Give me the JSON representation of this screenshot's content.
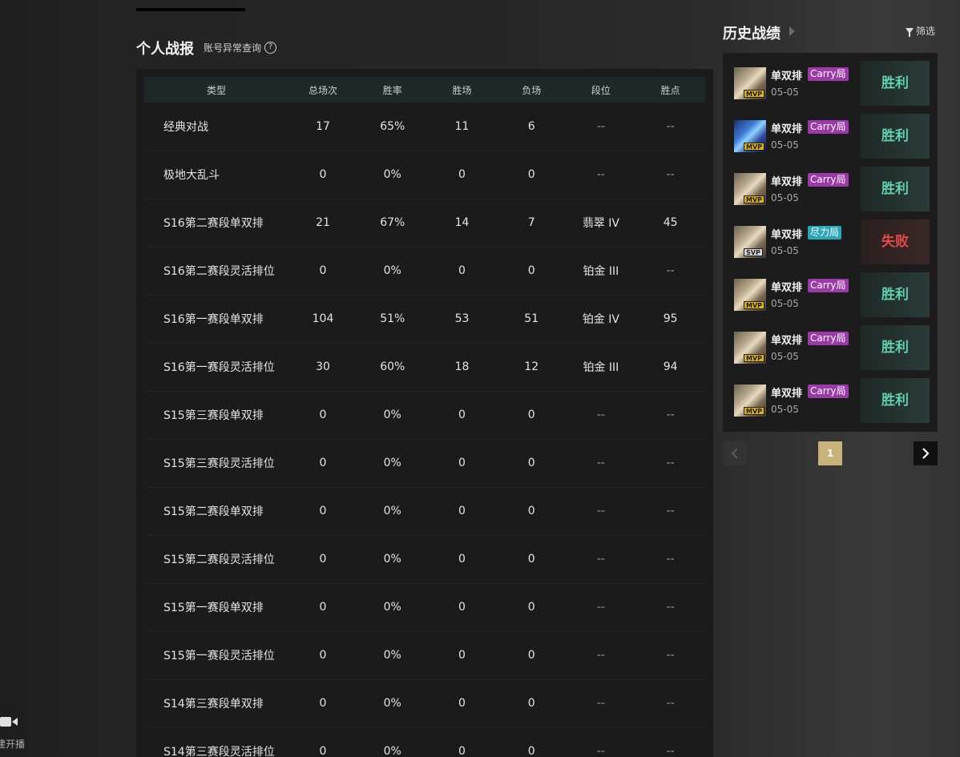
{
  "sidebar": {
    "live_label": "建开播"
  },
  "report": {
    "title": "个人战报",
    "abnormal_query": "账号异常查询",
    "help_glyph": "?",
    "columns": [
      "类型",
      "总场次",
      "胜率",
      "胜场",
      "负场",
      "段位",
      "胜点"
    ],
    "rows": [
      [
        "经典对战",
        "17",
        "65%",
        "11",
        "6",
        "--",
        "--"
      ],
      [
        "极地大乱斗",
        "0",
        "0%",
        "0",
        "0",
        "--",
        "--"
      ],
      [
        "S16第二赛段单双排",
        "21",
        "67%",
        "14",
        "7",
        "翡翠 IV",
        "45"
      ],
      [
        "S16第二赛段灵活排位",
        "0",
        "0%",
        "0",
        "0",
        "铂金 III",
        "--"
      ],
      [
        "S16第一赛段单双排",
        "104",
        "51%",
        "53",
        "51",
        "铂金 IV",
        "95"
      ],
      [
        "S16第一赛段灵活排位",
        "30",
        "60%",
        "18",
        "12",
        "铂金 III",
        "94"
      ],
      [
        "S15第三赛段单双排",
        "0",
        "0%",
        "0",
        "0",
        "--",
        "--"
      ],
      [
        "S15第三赛段灵活排位",
        "0",
        "0%",
        "0",
        "0",
        "--",
        "--"
      ],
      [
        "S15第二赛段单双排",
        "0",
        "0%",
        "0",
        "0",
        "--",
        "--"
      ],
      [
        "S15第二赛段灵活排位",
        "0",
        "0%",
        "0",
        "0",
        "--",
        "--"
      ],
      [
        "S15第一赛段单双排",
        "0",
        "0%",
        "0",
        "0",
        "--",
        "--"
      ],
      [
        "S15第一赛段灵活排位",
        "0",
        "0%",
        "0",
        "0",
        "--",
        "--"
      ],
      [
        "S14第三赛段单双排",
        "0",
        "0%",
        "0",
        "0",
        "--",
        "--"
      ],
      [
        "S14第三赛段灵活排位",
        "0",
        "0%",
        "0",
        "0",
        "--",
        "--"
      ]
    ]
  },
  "history": {
    "title": "历史战绩",
    "filter_label": "筛选",
    "matches": [
      {
        "mode": "单双排",
        "tag": "Carry局",
        "tag_kind": "carry",
        "date": "05-05",
        "badge": "MVP",
        "result": "胜利",
        "outcome": "win",
        "avatar": "gold"
      },
      {
        "mode": "单双排",
        "tag": "Carry局",
        "tag_kind": "carry",
        "date": "05-05",
        "badge": "MVP",
        "result": "胜利",
        "outcome": "win",
        "avatar": "blue"
      },
      {
        "mode": "单双排",
        "tag": "Carry局",
        "tag_kind": "carry",
        "date": "05-05",
        "badge": "MVP",
        "result": "胜利",
        "outcome": "win",
        "avatar": "gold"
      },
      {
        "mode": "单双排",
        "tag": "尽力局",
        "tag_kind": "effort",
        "date": "05-05",
        "badge": "SVP",
        "result": "失败",
        "outcome": "loss",
        "avatar": "gold"
      },
      {
        "mode": "单双排",
        "tag": "Carry局",
        "tag_kind": "carry",
        "date": "05-05",
        "badge": "MVP",
        "result": "胜利",
        "outcome": "win",
        "avatar": "gold"
      },
      {
        "mode": "单双排",
        "tag": "Carry局",
        "tag_kind": "carry",
        "date": "05-05",
        "badge": "MVP",
        "result": "胜利",
        "outcome": "win",
        "avatar": "gold"
      },
      {
        "mode": "单双排",
        "tag": "Carry局",
        "tag_kind": "carry",
        "date": "05-05",
        "badge": "MVP",
        "result": "胜利",
        "outcome": "win",
        "avatar": "gold"
      }
    ],
    "pagination": {
      "current_page": "1"
    }
  },
  "colors": {
    "win_text": "#5fd0b2",
    "loss_text": "#e04a4a",
    "carry_tag": "#9b3aa8",
    "effort_tag": "#2aa7b8",
    "mvp_badge": "#e0b400",
    "page_active": "#c9b27a"
  },
  "icons": {
    "live": "video-camera-icon",
    "help": "question-circle-icon",
    "history_expand": "caret-right-icon",
    "filter": "funnel-icon",
    "prev": "chevron-left-icon",
    "next": "chevron-right-icon"
  }
}
